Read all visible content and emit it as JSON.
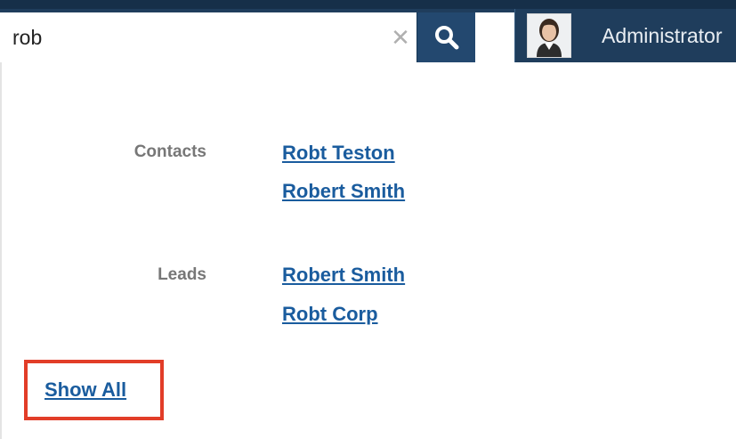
{
  "header": {
    "search_value": "rob",
    "clear_icon": "close-icon",
    "search_icon": "search-icon",
    "user_label": "Administrator",
    "avatar_icon": "user-avatar"
  },
  "results": {
    "groups": [
      {
        "label": "Contacts",
        "items": [
          "Robt Teston",
          "Robert Smith"
        ]
      },
      {
        "label": "Leads",
        "items": [
          "Robert Smith",
          "Robt Corp"
        ]
      }
    ],
    "show_all_label": "Show All"
  },
  "colors": {
    "header_bg": "#1f3d5c",
    "search_button_bg": "#23486f",
    "link": "#1a5c9e",
    "highlight_box": "#e23d28"
  }
}
